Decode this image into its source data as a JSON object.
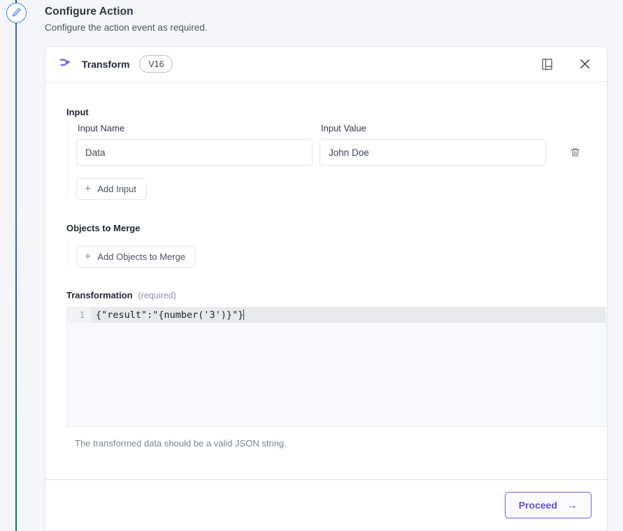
{
  "page": {
    "title": "Configure Action",
    "subtitle": "Configure the action event as required."
  },
  "rail": {
    "node_icon": "pencil-icon",
    "gradient_start": "#3b5bdb",
    "gradient_end": "#0f766e"
  },
  "card": {
    "header": {
      "icon": "transform-icon",
      "title": "Transform",
      "version_badge": "V16",
      "actions": [
        {
          "icon": "panel-layout-icon",
          "name": "toggle-panel-button"
        },
        {
          "icon": "close-icon",
          "name": "close-button"
        }
      ]
    },
    "input_section": {
      "title": "Input",
      "name_label": "Input Name",
      "value_label": "Input Value",
      "name_value": "Data",
      "name_placeholder": "Input Name",
      "value_value": "John Doe",
      "value_placeholder": "Input Value",
      "delete_icon": "trash-icon",
      "add_button": "Add Input"
    },
    "objects_section": {
      "title": "Objects to Merge",
      "add_button": "Add Objects to Merge"
    },
    "transformation_section": {
      "title": "Transformation",
      "required_note": "(required)",
      "line_number": "1",
      "code": "{\"result\":\"{number('3')}\"}",
      "hint": "The transformed data should be a valid JSON string."
    },
    "footer": {
      "proceed_label": "Proceed",
      "proceed_arrow": "→",
      "accent_color": "#5b4ddb"
    }
  }
}
